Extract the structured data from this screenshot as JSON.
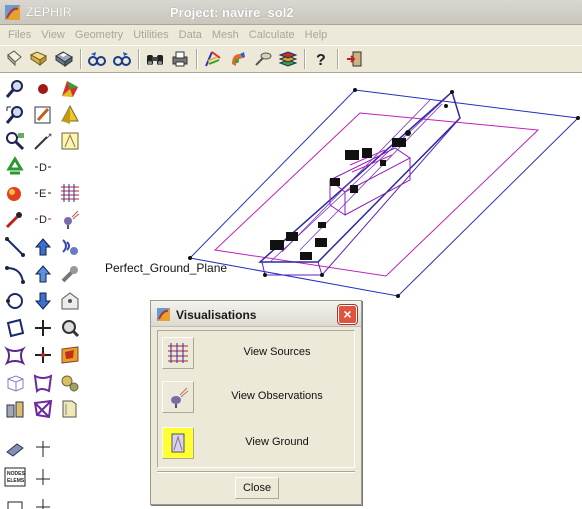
{
  "app": {
    "name": "ZEPHIR",
    "window_title": "Project: navire_sol2"
  },
  "menu": [
    "Files",
    "View",
    "Geometry",
    "Utilities",
    "Data",
    "Mesh",
    "Calculate",
    "Help"
  ],
  "toolbar_icons": [
    "new-file-icon",
    "open-folder-icon",
    "save-disk-icon",
    "link-left-icon",
    "link-right-icon",
    "binoculars-icon",
    "printer-icon",
    "spectrum-icon",
    "paint-icon",
    "probe-icon",
    "layers-icon",
    "help-icon",
    "exit-door-icon"
  ],
  "canvas": {
    "ground_label": "Perfect_Ground_Plane"
  },
  "dialog": {
    "title": "Visualisations",
    "rows": [
      {
        "label": "View Sources",
        "icon": "sources-grid-icon",
        "active": false
      },
      {
        "label": "View Observations",
        "icon": "observation-dish-icon",
        "active": false
      },
      {
        "label": "View Ground",
        "icon": "ground-plane-icon",
        "active": true
      }
    ],
    "close_label": "Close"
  }
}
